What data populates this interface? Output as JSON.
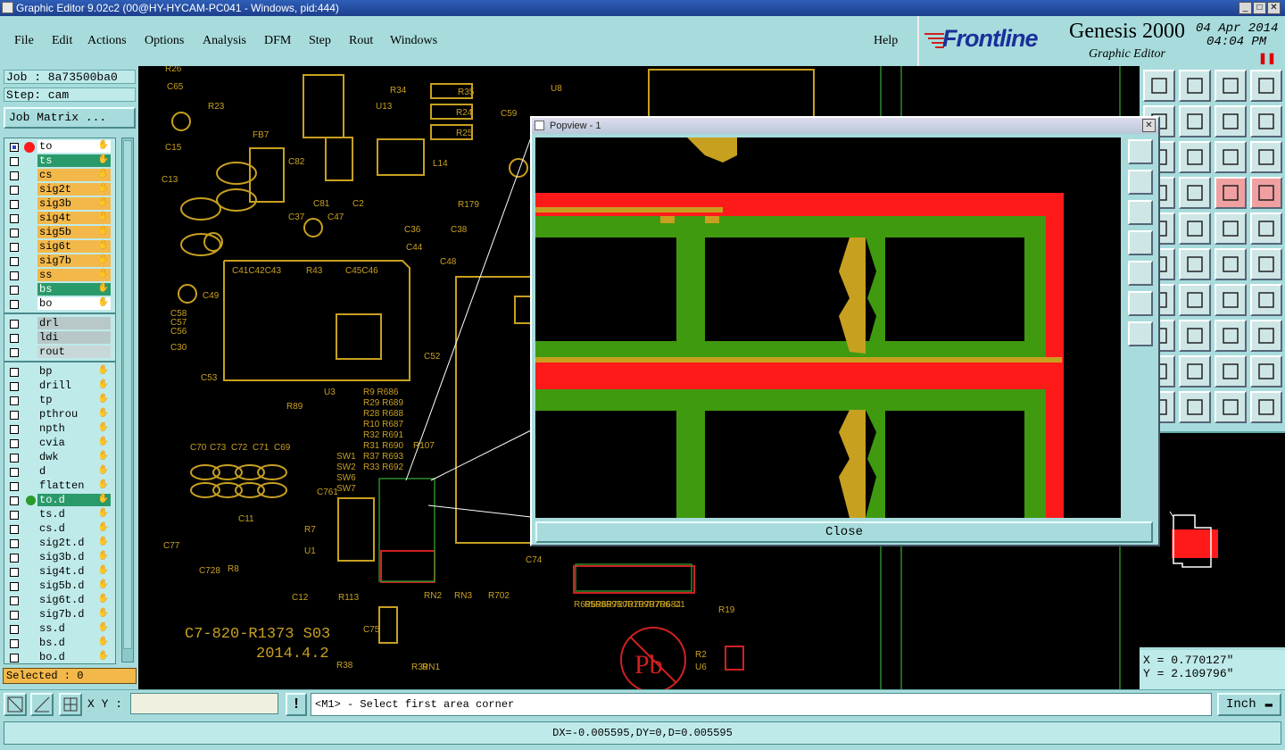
{
  "window": {
    "title": "Graphic Editor 9.02c2 (00@HY-HYCAM-PC041 - Windows, pid:444)"
  },
  "menu": {
    "items": [
      "File",
      "Edit",
      "Actions",
      "Options",
      "Analysis",
      "DFM",
      "Step",
      "Rout",
      "Windows"
    ],
    "help": "Help"
  },
  "brand": {
    "logo": "Frontline",
    "product": "Genesis 2000",
    "subtitle": "Graphic Editor",
    "date": "04 Apr 2014",
    "time": "04:04 PM"
  },
  "job": {
    "job_label": "Job : 8a73500ba0",
    "step_label": "Step: cam",
    "matrix_button": "Job Matrix ..."
  },
  "layers": {
    "group1": [
      "to",
      "ts",
      "cs",
      "sig2t",
      "sig3b",
      "sig4t",
      "sig5b",
      "sig6t",
      "sig7b",
      "ss",
      "bs",
      "bo"
    ],
    "group2": [
      "drl",
      "ldi",
      "rout"
    ],
    "group3": [
      "bp",
      "drill",
      "tp",
      "pthrou",
      "npth",
      "cvia",
      "dwk",
      "d",
      "flatten",
      "to.d",
      "ts.d",
      "cs.d",
      "sig2t.d",
      "sig3b.d",
      "sig4t.d",
      "sig5b.d",
      "sig6t.d",
      "sig7b.d",
      "ss.d",
      "bs.d",
      "bo.d"
    ]
  },
  "selected": "Selected : 0",
  "xy_label": "X Y :",
  "xy_value": "",
  "prompt": "<M1> - Select first area corner",
  "units": "Inch",
  "status": "DX=-0.005595,DY=0,D=0.005595",
  "coords": {
    "x": "X = 0.770127\"",
    "y": "Y = 2.109796\""
  },
  "popview": {
    "title": "Popview - 1",
    "close": "Close"
  },
  "board_labels": {
    "text1": "C7-820-R1373 S03",
    "text2": "2014.4.2",
    "pb": "Pb",
    "refs": [
      "R26",
      "C65",
      "R23",
      "FB7",
      "C15",
      "C13",
      "C82",
      "C81",
      "C2",
      "R34",
      "U13",
      "R35",
      "R24",
      "R25",
      "C59",
      "U8",
      "L14",
      "R179",
      "C37",
      "C47",
      "C36",
      "C44",
      "C38",
      "C48",
      "C41C42C43",
      "R43",
      "C45C46",
      "C49",
      "C58",
      "C57",
      "C56",
      "C30",
      "C53",
      "C52",
      "U3",
      "R89",
      "R9 R686",
      "R29 R689",
      "R28 R688",
      "R10 R687",
      "R32 R691",
      "R31 R690",
      "R37 R693",
      "R33 R692",
      "R107",
      "SW1",
      "SW2",
      "SW6",
      "SW7",
      "C761",
      "C70",
      "C73",
      "C72",
      "C71",
      "C69",
      "C11",
      "C77",
      "C728",
      "C12",
      "R7",
      "R8",
      "U1",
      "C74",
      "R113",
      "C75",
      "R38",
      "R39",
      "RN1",
      "RN2",
      "RN3",
      "R702",
      "R695",
      "R698",
      "R699",
      "R710",
      "R701",
      "R709",
      "R707",
      "R706",
      "R684",
      "C1",
      "R19",
      "R2",
      "U6"
    ]
  }
}
